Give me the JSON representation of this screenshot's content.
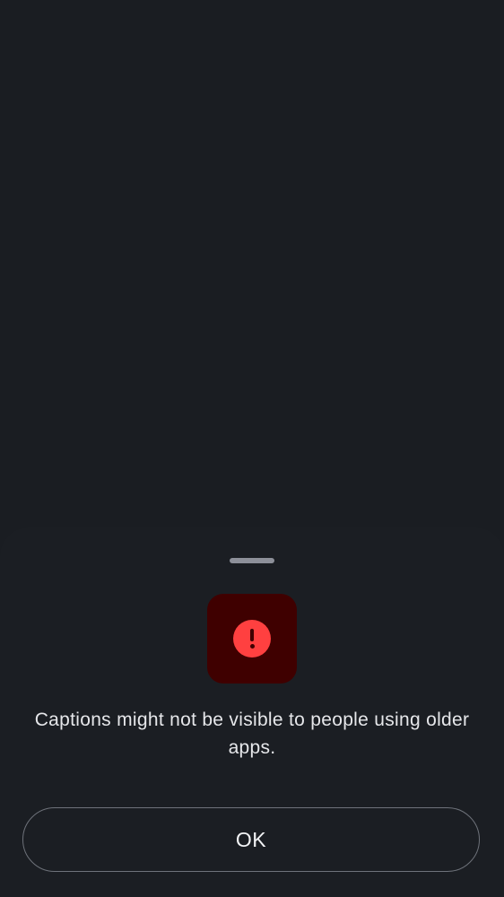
{
  "dialog": {
    "message": "Captions might not be visible to people using older apps.",
    "ok_label": "OK"
  },
  "icons": {
    "alert": "alert-circle-icon"
  },
  "colors": {
    "background": "#1a1d22",
    "sheet": "#1b1e23",
    "icon_tile": "#3f0000",
    "alert_red": "#ff4040",
    "button_border": "#6e727a",
    "text": "#e6e7ea"
  }
}
